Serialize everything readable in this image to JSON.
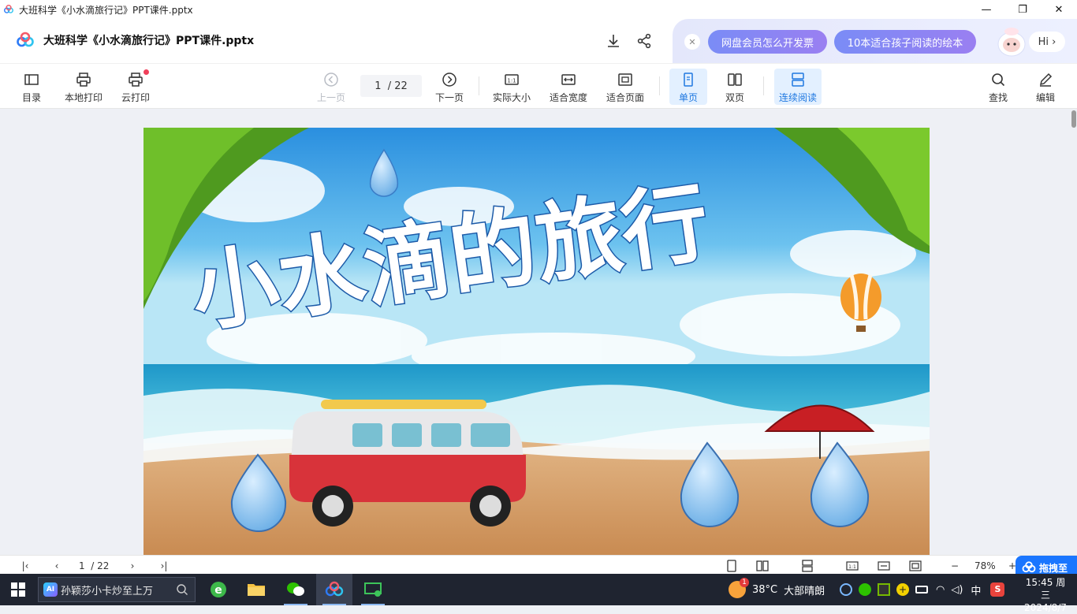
{
  "window": {
    "title": "大班科学《小水滴旅行记》PPT课件.pptx",
    "controls": [
      "—",
      "❐",
      "✕"
    ]
  },
  "header": {
    "file_name": "大班科学《小水滴旅行记》PPT课件.pptx",
    "promo": {
      "pill1": "网盘会员怎么开发票",
      "pill2": "10本适合孩子阅读的绘本",
      "hi": "Hi"
    }
  },
  "toolbar": {
    "toc": "目录",
    "local_print": "本地打印",
    "cloud_print": "云打印",
    "prev_page": "上一页",
    "page_current": "1",
    "page_total": "/ 22",
    "next_page": "下一页",
    "actual_size": "实际大小",
    "fit_width": "适合宽度",
    "fit_page": "适合页面",
    "single_page": "单页",
    "double_page": "双页",
    "continuous": "连续阅读",
    "find": "查找",
    "edit": "编辑"
  },
  "slide": {
    "title": "小水滴的旅行",
    "colors": {
      "sky_top": "#2f9be3",
      "sea": "#36b6d8",
      "sand": "#d9a06a",
      "van_red": "#d8333a",
      "drop_blue": "#8ec3ef"
    }
  },
  "statusbar": {
    "page_current": "1",
    "page_total": "/ 22",
    "zoom": "78%",
    "float_label": "拖拽至"
  },
  "taskbar": {
    "search_text": "孙颖莎小卡炒至上万",
    "ai_badge": "AI",
    "weather_temp": "38°C",
    "weather_desc": "大部晴朗",
    "weather_badge": "1",
    "ime": "中",
    "time": "15:45 周三",
    "date": "2024/8/7"
  }
}
